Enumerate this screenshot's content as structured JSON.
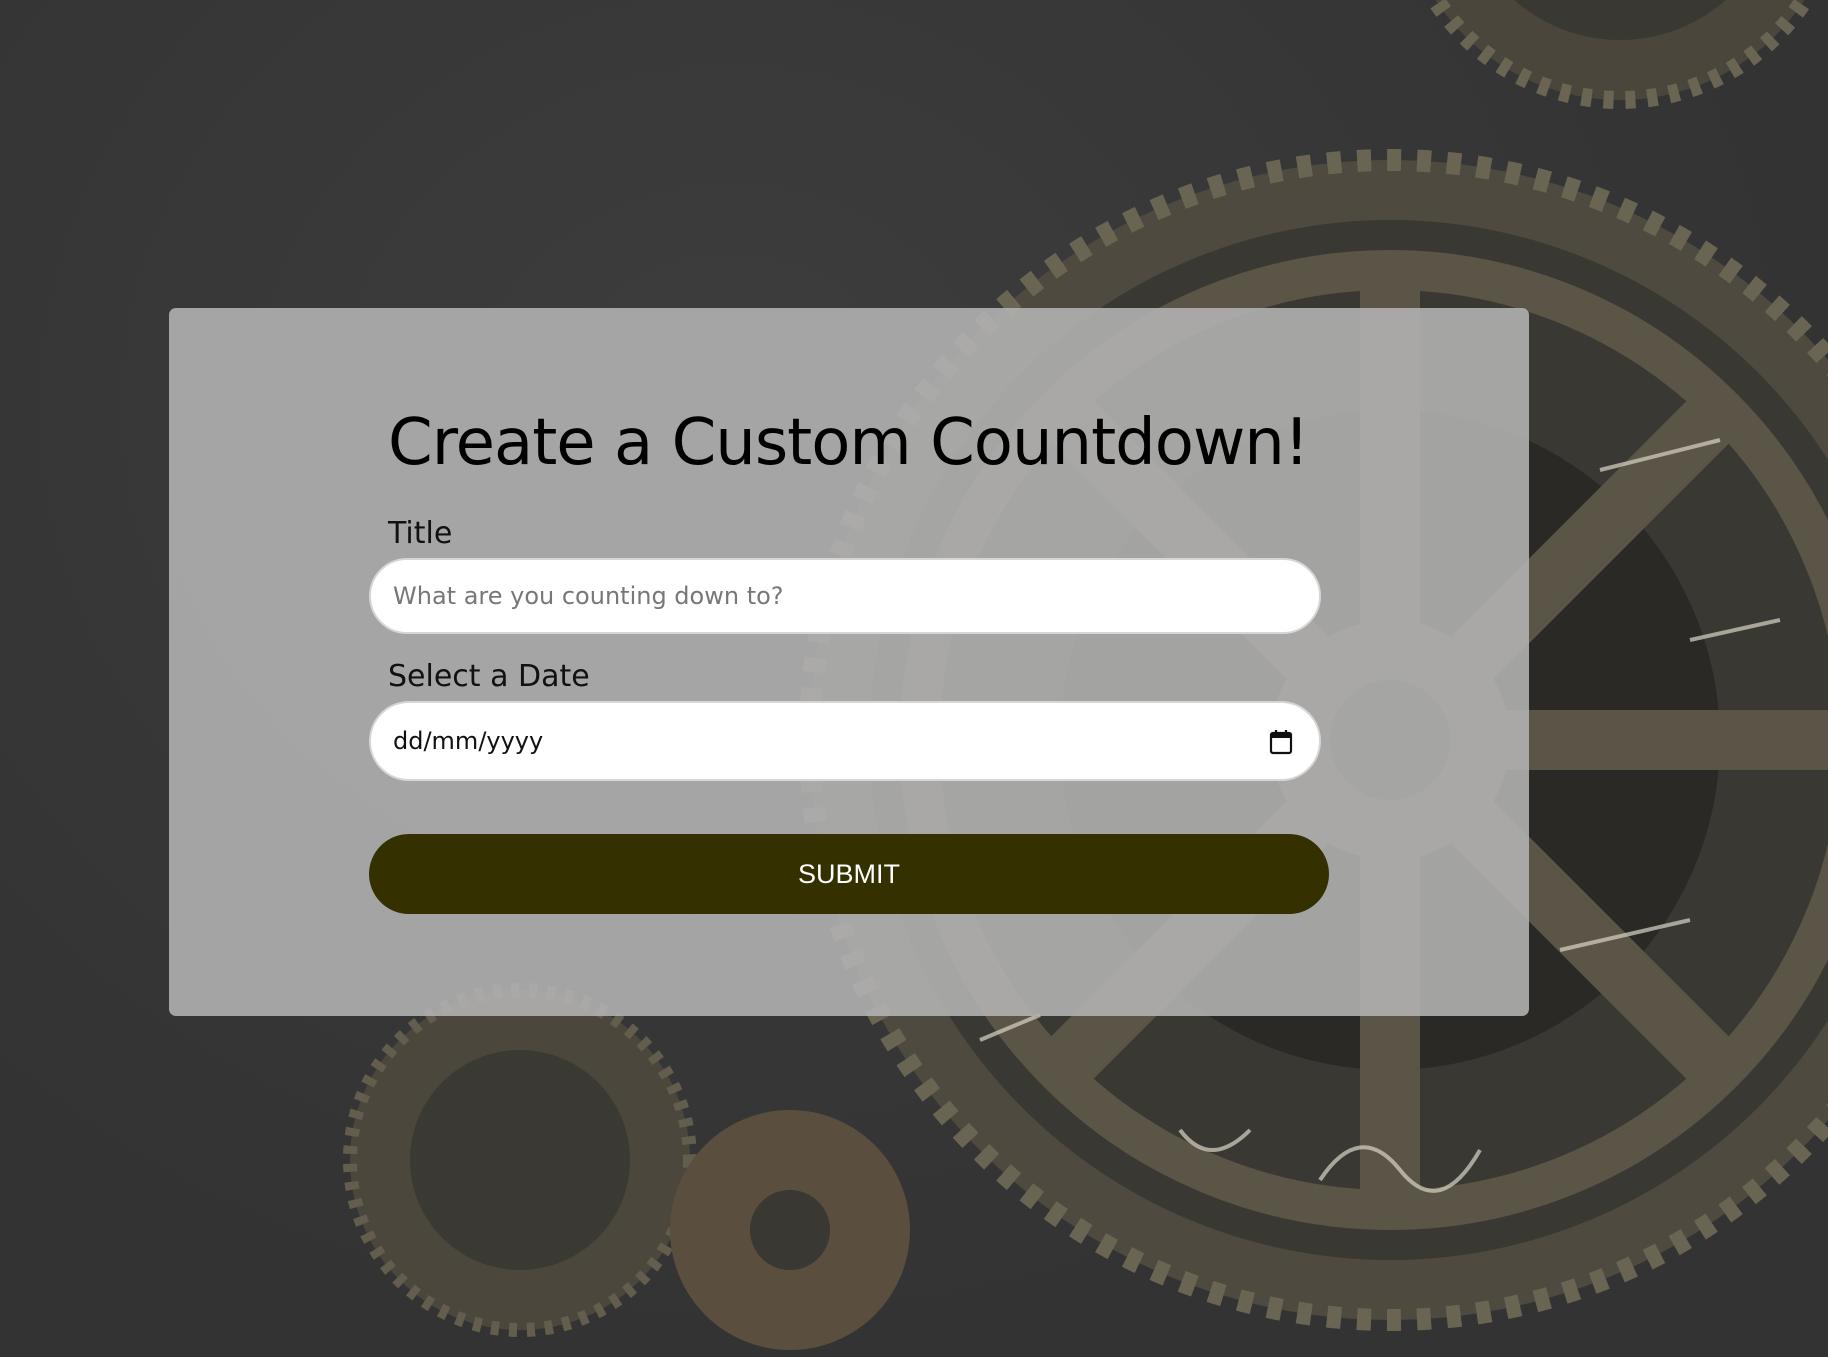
{
  "background": {
    "description_icon": "gears-icon",
    "page_color": "#3a3a3a"
  },
  "form": {
    "heading": "Create a Custom Countdown!",
    "title_label": "Title",
    "title_placeholder": "What are you counting down to?",
    "title_value": "",
    "date_label": "Select a Date",
    "date_placeholder": "dd/mm/yyyy",
    "date_icon": "calendar-icon",
    "submit_label": "SUBMIT",
    "submit_color": "#343000",
    "card_color": "#b4b4b4"
  }
}
